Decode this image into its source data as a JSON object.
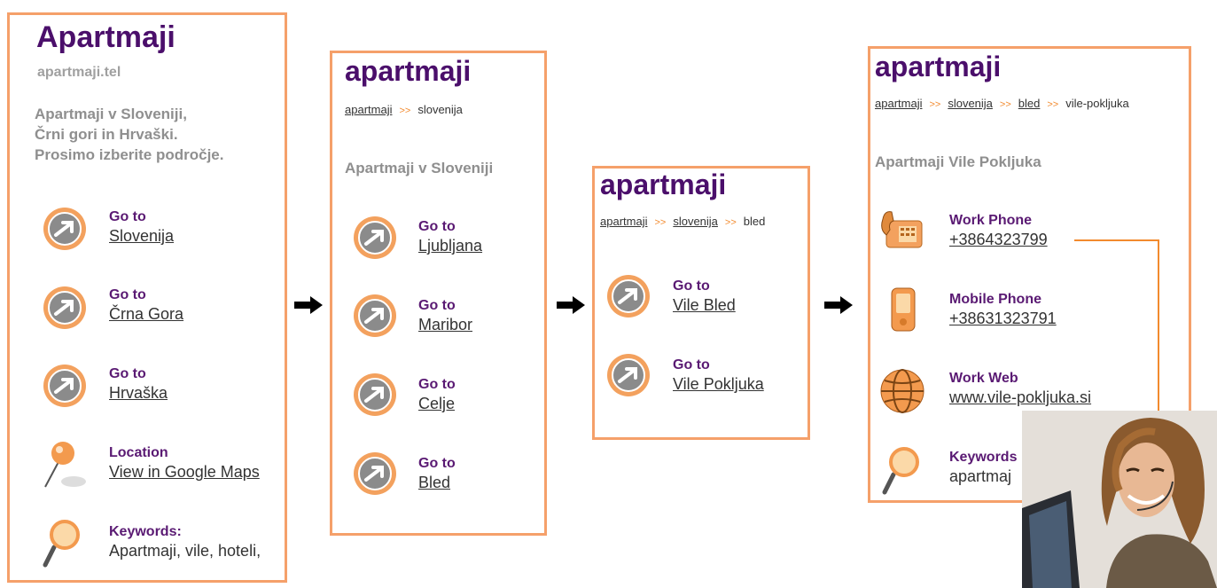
{
  "panel1": {
    "title": "Apartmaji",
    "domain": "apartmaji.tel",
    "description": [
      "Apartmaji v Sloveniji,",
      "Črni gori in Hrvaški.",
      "Prosimo izberite področje."
    ],
    "items": [
      {
        "label": "Go to",
        "value": "Slovenija",
        "icon": "arrow-circle-icon"
      },
      {
        "label": "Go to",
        "value": "Črna Gora",
        "icon": "arrow-circle-icon"
      },
      {
        "label": "Go to",
        "value": "Hrvaška",
        "icon": "arrow-circle-icon"
      },
      {
        "label": "Location",
        "value": "View in Google Maps",
        "icon": "map-pin-icon"
      },
      {
        "label": "Keywords:",
        "value": "Apartmaji, vile, hoteli,",
        "icon": "magnifier-icon"
      }
    ]
  },
  "panel2": {
    "title": "apartmaji",
    "breadcrumb": [
      "apartmaji",
      ">>",
      "slovenija"
    ],
    "subtitle": "Apartmaji v Sloveniji",
    "items": [
      {
        "label": "Go to",
        "value": "Ljubljana"
      },
      {
        "label": "Go to",
        "value": "Maribor"
      },
      {
        "label": "Go to",
        "value": "Celje"
      },
      {
        "label": "Go to",
        "value": "Bled"
      }
    ]
  },
  "panel3": {
    "title": "apartmaji",
    "breadcrumb": [
      "apartmaji",
      ">>",
      "slovenija",
      ">>",
      "bled"
    ],
    "items": [
      {
        "label": "Go to",
        "value": "Vile Bled"
      },
      {
        "label": "Go to",
        "value": "Vile Pokljuka"
      }
    ]
  },
  "panel4": {
    "title": "apartmaji",
    "breadcrumb": [
      "apartmaji",
      ">>",
      "slovenija",
      ">>",
      "bled",
      ">>",
      "vile-pokljuka"
    ],
    "subtitle": "Apartmaji Vile Pokljuka",
    "items": [
      {
        "label": "Work Phone",
        "value": "+3864323799",
        "icon": "desk-phone-icon"
      },
      {
        "label": "Mobile Phone",
        "value": "+38631323791",
        "icon": "mobile-phone-icon"
      },
      {
        "label": "Work Web",
        "value": "www.vile-pokljuka.si",
        "icon": "globe-icon"
      },
      {
        "label": "Keywords",
        "value": "apartmaj",
        "icon": "magnifier-icon"
      }
    ]
  },
  "colors": {
    "accent": "#f5a06a",
    "title": "#4b0f6b",
    "label": "#5a1a73",
    "muted": "#8f8f8f"
  }
}
